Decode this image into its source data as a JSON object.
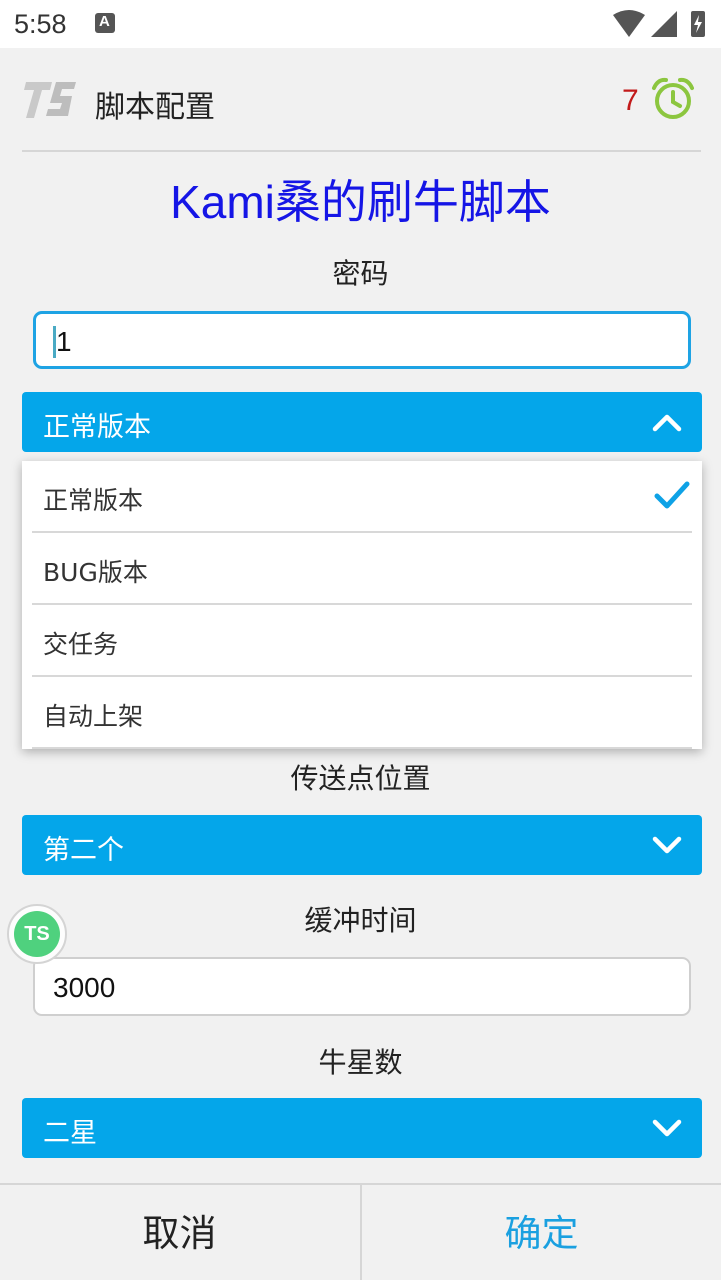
{
  "status_bar": {
    "time": "5:58",
    "notification_icon_letter": "A",
    "icons": [
      "wifi-icon",
      "signal-icon",
      "battery-charging-icon"
    ]
  },
  "header": {
    "logo": "TS",
    "title": "脚本配置",
    "countdown": "7",
    "countdown_color": "#c21a1a",
    "alarm_icon_color": "#8cc63f"
  },
  "main": {
    "script_title": "Kami桑的刷牛脚本",
    "script_title_color": "#1515e6",
    "password": {
      "label": "密码",
      "value": "1"
    },
    "mode_dropdown": {
      "selected": "正常版本",
      "expanded": true,
      "options": [
        "正常版本",
        "BUG版本",
        "交任务",
        "自动上架"
      ],
      "checked_option": "正常版本"
    },
    "teleport": {
      "label": "传送点位置",
      "selected": "第二个"
    },
    "buffer": {
      "label": "缓冲时间",
      "value": "3000"
    },
    "stars": {
      "label": "牛星数",
      "selected": "二星"
    },
    "accent_color": "#04a6ea"
  },
  "floating_badge": "TS",
  "footer": {
    "cancel_label": "取消",
    "confirm_label": "确定",
    "confirm_color": "#1aa0e0"
  }
}
